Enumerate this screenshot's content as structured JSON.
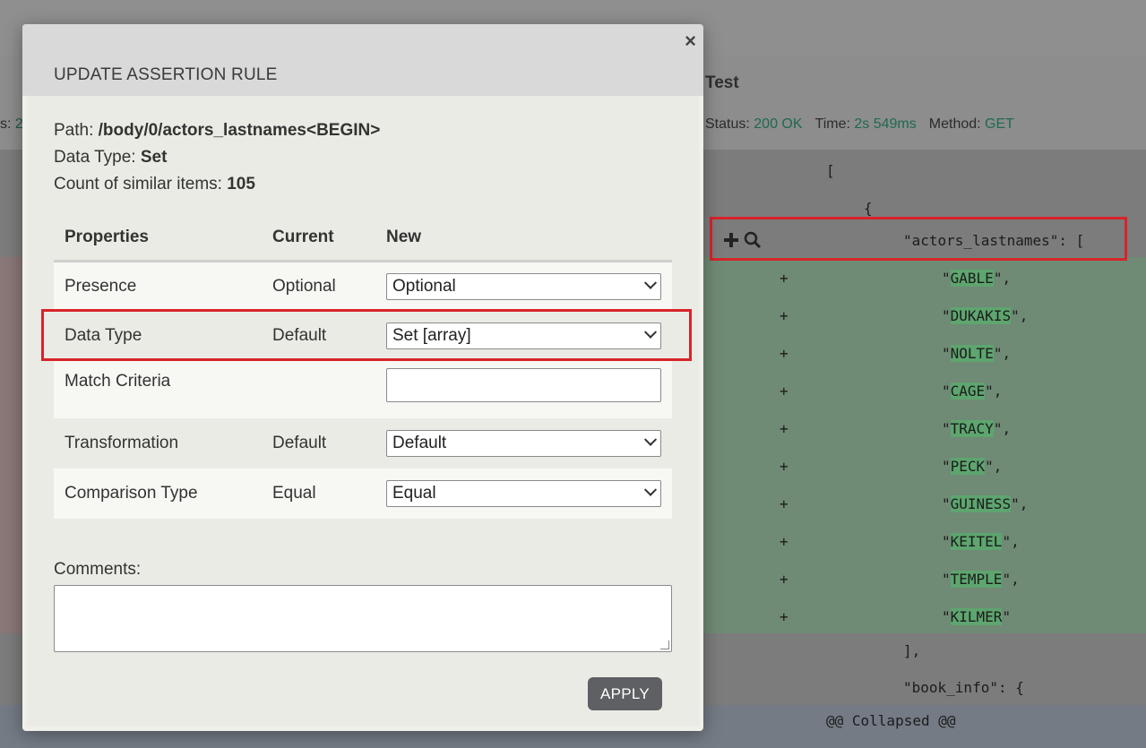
{
  "background": {
    "page_title": "Test",
    "left_fragment_label": "s:",
    "left_fragment_value": "2",
    "status_label": "Status:",
    "status_value": "200 OK",
    "time_label": "Time:",
    "time_value": "2s 549ms",
    "method_label": "Method:",
    "method_value": "GET",
    "code_lines": {
      "open_bracket": "[",
      "open_brace": "{",
      "actors_key": "\"actors_lastnames\": [",
      "close_list": "],",
      "book_info": "\"book_info\": {",
      "collapsed": "@@ Collapsed @@"
    },
    "added_items": [
      {
        "name": "GABLE",
        "suffix": "\","
      },
      {
        "name": "DUKAKIS",
        "suffix": "\","
      },
      {
        "name": "NOLTE",
        "suffix": "\","
      },
      {
        "name": "CAGE",
        "suffix": "\","
      },
      {
        "name": "TRACY",
        "suffix": "\","
      },
      {
        "name": "PECK",
        "suffix": "\","
      },
      {
        "name": "GUINESS",
        "suffix": "\","
      },
      {
        "name": "KEITEL",
        "suffix": "\","
      },
      {
        "name": "TEMPLE",
        "suffix": "\","
      },
      {
        "name": "KILMER",
        "suffix": "\""
      }
    ],
    "plus_sign": "+",
    "add_icon": "plus-icon",
    "search_icon": "search-icon"
  },
  "modal": {
    "title": "UPDATE ASSERTION RULE",
    "close_glyph": "×",
    "path_label": "Path:",
    "path_value": "/body/0/actors_lastnames<BEGIN>",
    "data_type_label": "Data Type:",
    "data_type_value": "Set",
    "count_label": "Count of similar items:",
    "count_value": "105",
    "table": {
      "headers": [
        "Properties",
        "Current",
        "New"
      ],
      "rows": [
        {
          "property": "Presence",
          "current": "Optional",
          "new": "Optional"
        },
        {
          "property": "Data Type",
          "current": "Default",
          "new": "Set [array]"
        },
        {
          "property": "Match Criteria",
          "current": "",
          "new": ""
        },
        {
          "property": "Transformation",
          "current": "Default",
          "new": "Default"
        },
        {
          "property": "Comparison Type",
          "current": "Equal",
          "new": "Equal"
        }
      ]
    },
    "comments_label": "Comments:",
    "comments_value": "",
    "apply_label": "APPLY"
  },
  "colors": {
    "highlight_border": "#d8232a",
    "status_value": "#1e6a4d",
    "apply_button": "#5f6063"
  }
}
